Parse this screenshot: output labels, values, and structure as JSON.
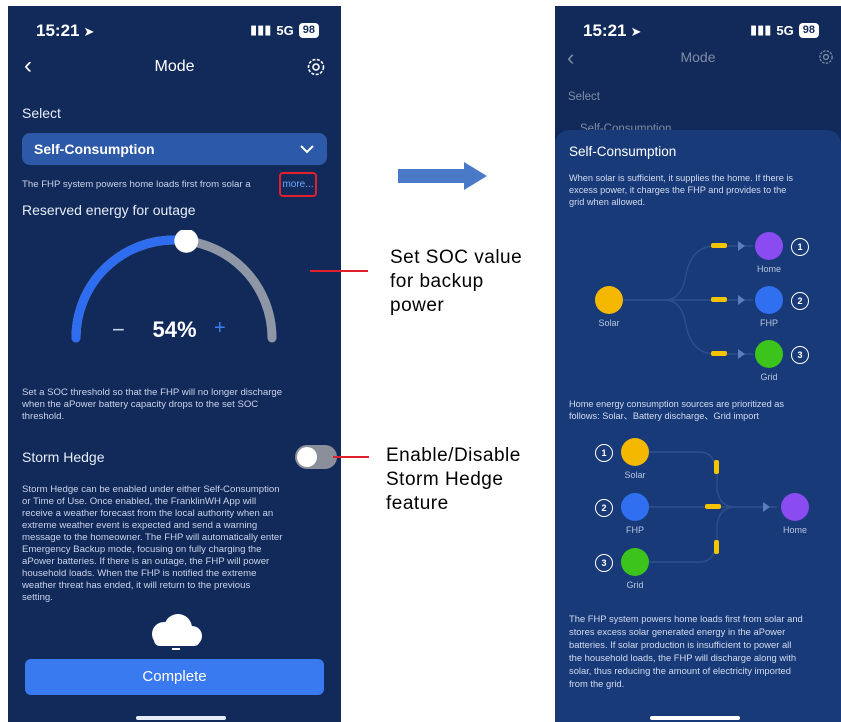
{
  "left": {
    "status": {
      "time": "15:21",
      "signal": "5G",
      "battery": "98"
    },
    "nav": {
      "title": "Mode"
    },
    "select_label": "Select",
    "select_value": "Self-Consumption",
    "summary": "The FHP system powers home loads first from solar a",
    "more_link": "more...",
    "reserved_title": "Reserved energy for outage",
    "soc_value": "54%",
    "soc_percent": 54,
    "minus": "−",
    "plus": "+",
    "soc_help": [
      "Set a SOC threshold so that the FHP will no longer discharge",
      "when the aPower battery capacity drops to the set SOC",
      "threshold."
    ],
    "storm_title": "Storm Hedge",
    "storm_enabled": false,
    "storm_desc": [
      "Storm Hedge can be enabled under either Self-Consumption",
      "or Time of Use. Once enabled, the FranklinWH App will",
      "receive a weather forecast from the local authority when an",
      "extreme weather event is expected and send a warning",
      "message to the homeowner. The FHP will automatically enter",
      "Emergency Backup mode, focusing on fully charging the",
      "aPower batteries. If there is an outage, the FHP will power",
      "household loads. When the FHP is notified the extreme",
      "weather threat has ended, it will return to the previous",
      "setting."
    ],
    "complete": "Complete"
  },
  "annotations": {
    "soc": [
      "Set SOC value",
      "for backup",
      "power"
    ],
    "storm": [
      "Enable/Disable",
      "Storm Hedge",
      "feature"
    ]
  },
  "right": {
    "status": {
      "time": "15:21",
      "signal": "5G",
      "battery": "98"
    },
    "nav": {
      "title": "Mode"
    },
    "select_label": "Select",
    "select_value": "Self-Consumption",
    "sheet_title": "Self-Consumption",
    "intro": [
      "When solar is sufficient, it supplies the home. If there is",
      "excess power, it charges the FHP and provides to the",
      "grid when allowed."
    ],
    "flow1": {
      "source": "Solar",
      "targets": [
        "Home",
        "FHP",
        "Grid"
      ],
      "numbers": [
        "1",
        "2",
        "3"
      ]
    },
    "priority": [
      "Home energy consumption sources are prioritized as",
      "follows: Solar、Battery discharge、Grid import"
    ],
    "flow2": {
      "sources": [
        "Solar",
        "FHP",
        "Grid"
      ],
      "target": "Home",
      "numbers": [
        "1",
        "2",
        "3"
      ]
    },
    "outro": [
      "The FHP system powers home loads first from solar and",
      "stores excess solar generated energy in the aPower",
      "batteries. If solar production is insufficient to power all",
      "the household loads, the FHP will discharge along with",
      "solar, thus reducing the amount of electricity imported",
      "from the grid."
    ]
  },
  "colors": {
    "bg": "#122a5a",
    "accent": "#3a7af0",
    "solar": "#f5b800",
    "home": "#8a4cf0",
    "fhp": "#2f6ff0",
    "grid": "#3cc41c",
    "annotation_line": "#e0202c"
  },
  "icons": [
    "location-arrow-icon",
    "back-chevron-icon",
    "gear-icon",
    "chevron-down-icon",
    "cloud-icon",
    "solar-panel-icon",
    "home-icon",
    "battery-icon",
    "grid-tower-icon",
    "right-arrow-icon"
  ]
}
